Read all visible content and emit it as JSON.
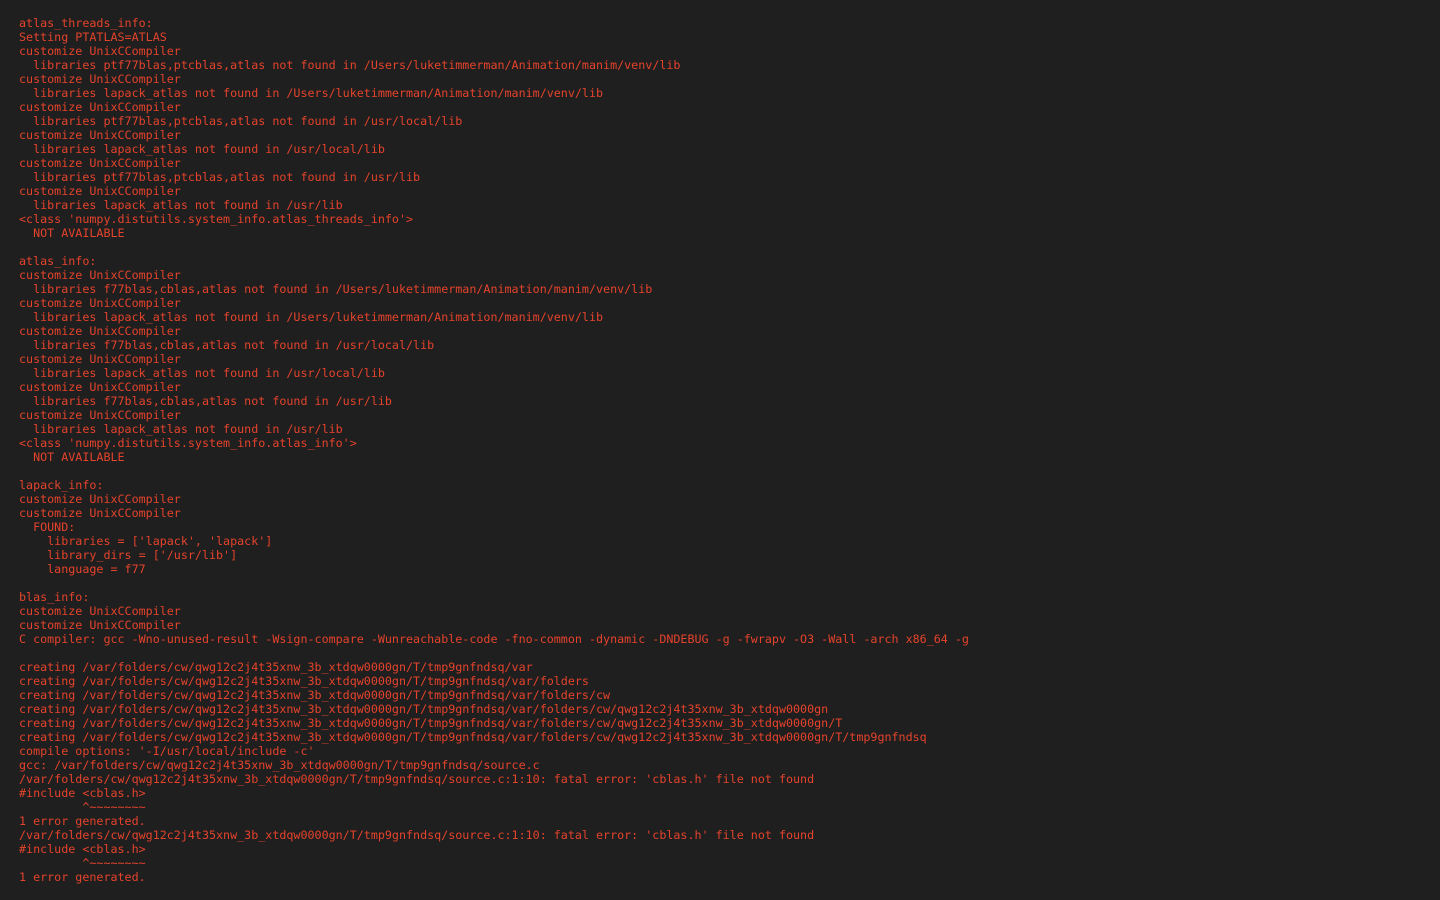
{
  "colors": {
    "background": "#1f1f1f",
    "text": "#e5432c"
  },
  "lines": [
    "atlas_threads_info:",
    "Setting PTATLAS=ATLAS",
    "customize UnixCCompiler",
    "  libraries ptf77blas,ptcblas,atlas not found in /Users/luketimmerman/Animation/manim/venv/lib",
    "customize UnixCCompiler",
    "  libraries lapack_atlas not found in /Users/luketimmerman/Animation/manim/venv/lib",
    "customize UnixCCompiler",
    "  libraries ptf77blas,ptcblas,atlas not found in /usr/local/lib",
    "customize UnixCCompiler",
    "  libraries lapack_atlas not found in /usr/local/lib",
    "customize UnixCCompiler",
    "  libraries ptf77blas,ptcblas,atlas not found in /usr/lib",
    "customize UnixCCompiler",
    "  libraries lapack_atlas not found in /usr/lib",
    "<class 'numpy.distutils.system_info.atlas_threads_info'>",
    "  NOT AVAILABLE",
    "",
    "atlas_info:",
    "customize UnixCCompiler",
    "  libraries f77blas,cblas,atlas not found in /Users/luketimmerman/Animation/manim/venv/lib",
    "customize UnixCCompiler",
    "  libraries lapack_atlas not found in /Users/luketimmerman/Animation/manim/venv/lib",
    "customize UnixCCompiler",
    "  libraries f77blas,cblas,atlas not found in /usr/local/lib",
    "customize UnixCCompiler",
    "  libraries lapack_atlas not found in /usr/local/lib",
    "customize UnixCCompiler",
    "  libraries f77blas,cblas,atlas not found in /usr/lib",
    "customize UnixCCompiler",
    "  libraries lapack_atlas not found in /usr/lib",
    "<class 'numpy.distutils.system_info.atlas_info'>",
    "  NOT AVAILABLE",
    "",
    "lapack_info:",
    "customize UnixCCompiler",
    "customize UnixCCompiler",
    "  FOUND:",
    "    libraries = ['lapack', 'lapack']",
    "    library_dirs = ['/usr/lib']",
    "    language = f77",
    "",
    "blas_info:",
    "customize UnixCCompiler",
    "customize UnixCCompiler",
    "C compiler: gcc -Wno-unused-result -Wsign-compare -Wunreachable-code -fno-common -dynamic -DNDEBUG -g -fwrapv -O3 -Wall -arch x86_64 -g",
    "",
    "creating /var/folders/cw/qwg12c2j4t35xnw_3b_xtdqw0000gn/T/tmp9gnfndsq/var",
    "creating /var/folders/cw/qwg12c2j4t35xnw_3b_xtdqw0000gn/T/tmp9gnfndsq/var/folders",
    "creating /var/folders/cw/qwg12c2j4t35xnw_3b_xtdqw0000gn/T/tmp9gnfndsq/var/folders/cw",
    "creating /var/folders/cw/qwg12c2j4t35xnw_3b_xtdqw0000gn/T/tmp9gnfndsq/var/folders/cw/qwg12c2j4t35xnw_3b_xtdqw0000gn",
    "creating /var/folders/cw/qwg12c2j4t35xnw_3b_xtdqw0000gn/T/tmp9gnfndsq/var/folders/cw/qwg12c2j4t35xnw_3b_xtdqw0000gn/T",
    "creating /var/folders/cw/qwg12c2j4t35xnw_3b_xtdqw0000gn/T/tmp9gnfndsq/var/folders/cw/qwg12c2j4t35xnw_3b_xtdqw0000gn/T/tmp9gnfndsq",
    "compile options: '-I/usr/local/include -c'",
    "gcc: /var/folders/cw/qwg12c2j4t35xnw_3b_xtdqw0000gn/T/tmp9gnfndsq/source.c",
    "/var/folders/cw/qwg12c2j4t35xnw_3b_xtdqw0000gn/T/tmp9gnfndsq/source.c:1:10: fatal error: 'cblas.h' file not found",
    "#include <cblas.h>",
    "         ^~~~~~~~~",
    "1 error generated.",
    "/var/folders/cw/qwg12c2j4t35xnw_3b_xtdqw0000gn/T/tmp9gnfndsq/source.c:1:10: fatal error: 'cblas.h' file not found",
    "#include <cblas.h>",
    "         ^~~~~~~~~",
    "1 error generated."
  ]
}
